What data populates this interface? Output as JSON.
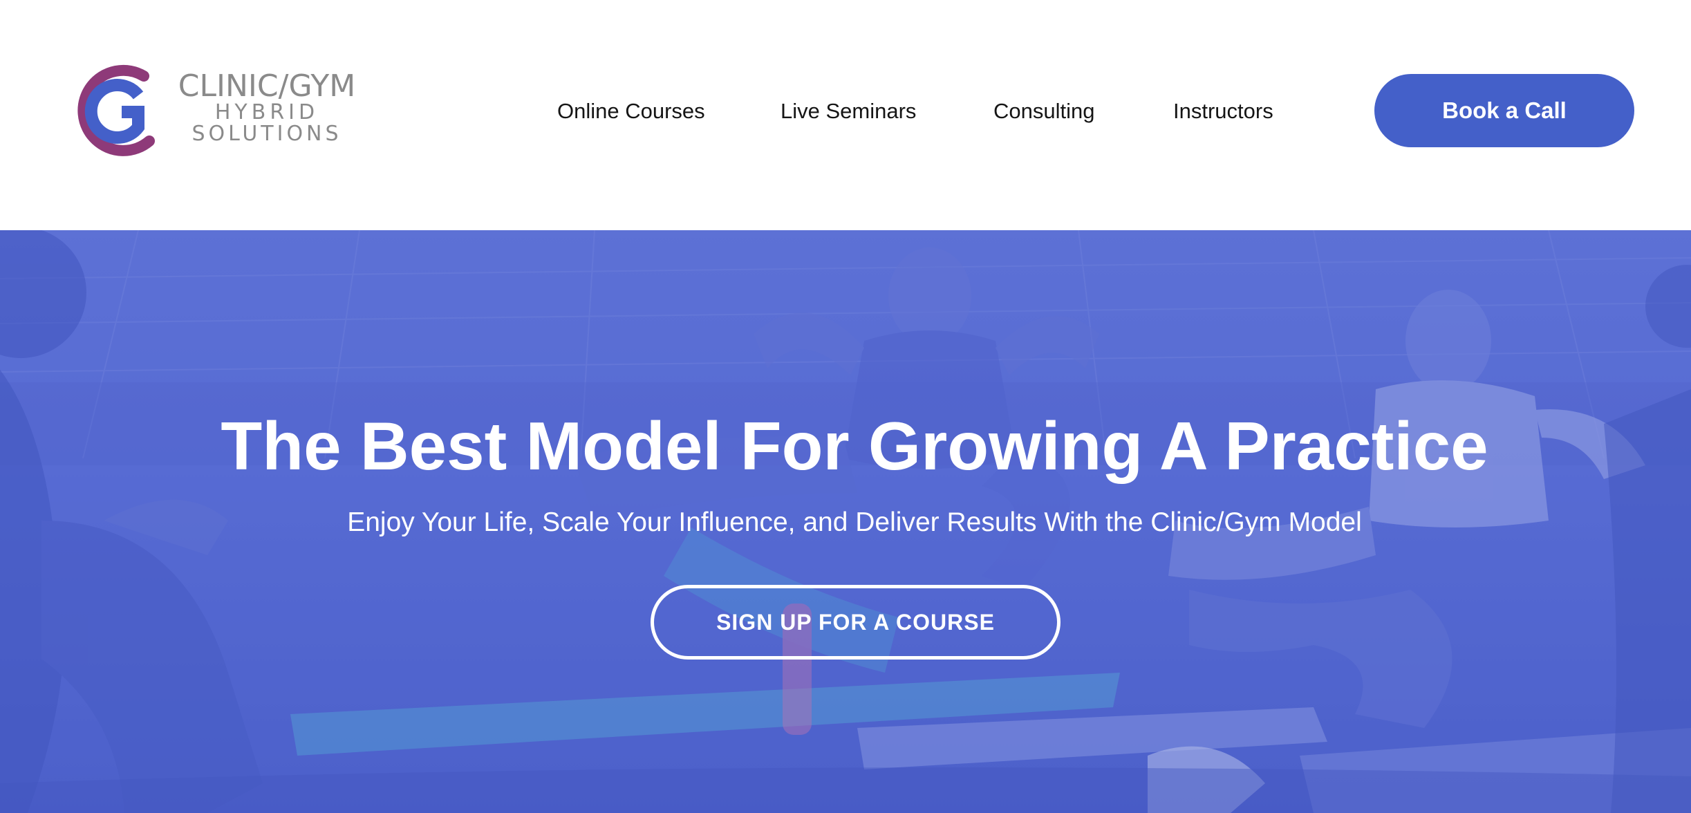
{
  "header": {
    "logo": {
      "line1": "CLINIC/GYM",
      "line2": "HYBRID",
      "line3": "SOLUTIONS",
      "icon": "clinic-gym-monogram-icon",
      "colors": {
        "outer_ring": "#8e3a79",
        "inner_mark": "#4460c9"
      }
    },
    "nav": [
      {
        "label": "Online Courses"
      },
      {
        "label": "Live Seminars"
      },
      {
        "label": "Consulting"
      },
      {
        "label": "Instructors"
      }
    ],
    "cta_label": "Book a Call"
  },
  "hero": {
    "title": "The Best Model For Growing A Practice",
    "subtitle": "Enjoy Your Life, Scale Your Influence, and Deliver Results With the Clinic/Gym Model",
    "cta_label": "SIGN UP FOR A COURSE",
    "background": "people-doing-sit-ups-on-mats-photo"
  },
  "colors": {
    "brand_blue": "#4460c9",
    "hero_tint": "#5568cf",
    "text_dark": "#151515",
    "logo_gray": "#8a8a8a"
  }
}
